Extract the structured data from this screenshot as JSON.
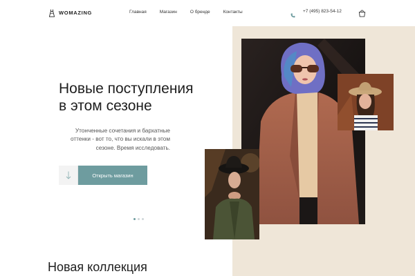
{
  "header": {
    "logo_text": "WOMAZING",
    "logo_icon": "dress-hanger-icon",
    "nav": [
      {
        "label": "Главная"
      },
      {
        "label": "Магазин"
      },
      {
        "label": "О бренде"
      },
      {
        "label": "Контакты"
      }
    ],
    "phone_icon": "phone-icon",
    "phone": "+7 (495) 823-54-12",
    "cart_icon": "shopping-bag-icon"
  },
  "hero": {
    "title_line1": "Новые поступления",
    "title_line2": "в этом сезоне",
    "text_line1": "Утонченные сочетания и бархатные",
    "text_line2": "оттенки - вот то, что вы искали в этом",
    "text_line3": "сезоне. Время исследовать.",
    "arrow_icon": "arrow-down-icon",
    "cta_label": "Открыть магазин",
    "slider_dots": 3,
    "active_dot": 1
  },
  "section": {
    "title": "Новая коллекция"
  },
  "colors": {
    "accent": "#6e9c9f",
    "beige": "#efe6d8",
    "text": "#1e1e1e"
  }
}
